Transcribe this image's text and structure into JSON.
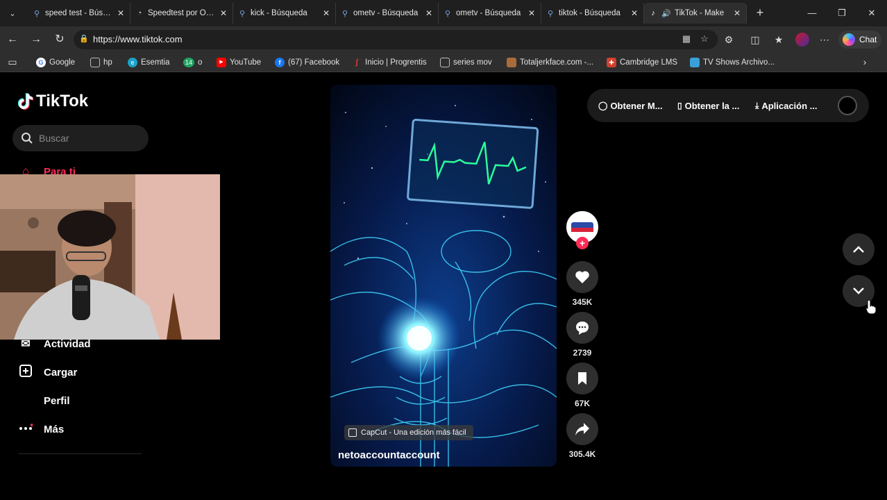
{
  "browser": {
    "tabs": [
      {
        "title": "speed test - Búsqueda",
        "icon": "search-icon"
      },
      {
        "title": "Speedtest por Ookla",
        "icon": "speedtest-icon"
      },
      {
        "title": "kick - Búsqueda",
        "icon": "search-icon"
      },
      {
        "title": "ometv - Búsqueda",
        "icon": "search-icon"
      },
      {
        "title": "ometv - Búsqueda",
        "icon": "search-icon"
      },
      {
        "title": "tiktok - Búsqueda",
        "icon": "search-icon"
      },
      {
        "title": "TikTok - Make",
        "icon": "tiktok-icon",
        "active": true,
        "audio": true
      }
    ],
    "url": "https://www.tiktok.com",
    "chat_label": "Chat",
    "bookmarks": [
      {
        "label": "Google",
        "icon": "google-icon",
        "color": "#4285f4"
      },
      {
        "label": "hp",
        "icon": "folder-icon",
        "color": "#888888"
      },
      {
        "label": "Esemtia",
        "icon": "esemtia-icon",
        "color": "#1aa3c9"
      },
      {
        "label": "o",
        "icon": "badge-14-icon",
        "color": "#1fa463",
        "badge": "14"
      },
      {
        "label": "YouTube",
        "icon": "youtube-icon",
        "color": "#ff0000"
      },
      {
        "label": "(67) Facebook",
        "icon": "facebook-icon",
        "color": "#1877f2"
      },
      {
        "label": "Inicio | Progrentis",
        "icon": "progrentis-icon",
        "color": "#e63b2e"
      },
      {
        "label": "series mov",
        "icon": "folder-icon",
        "color": "#888888"
      },
      {
        "label": "Totaljerkface.com -...",
        "icon": "site-icon",
        "color": "#aa6b3a"
      },
      {
        "label": "Cambridge LMS",
        "icon": "cambridge-icon",
        "color": "#d0402f"
      },
      {
        "label": "TV Shows Archivo...",
        "icon": "tv-icon",
        "color": "#3aa0d8"
      }
    ]
  },
  "tiktok": {
    "logo_text": "TikTok",
    "search_placeholder": "Buscar",
    "nav": [
      {
        "label": "Para ti",
        "icon": "home-icon",
        "active": true
      },
      {
        "label": "Actividad",
        "icon": "activity-icon"
      },
      {
        "label": "Cargar",
        "icon": "upload-icon"
      },
      {
        "label": "Perfil",
        "icon": "profile-icon"
      },
      {
        "label": "Más",
        "icon": "more-icon"
      }
    ],
    "top_pills": [
      {
        "label": "Obtener M...",
        "icon": "coin-icon"
      },
      {
        "label": "Obtener la ...",
        "icon": "phone-icon"
      },
      {
        "label": "Aplicación ...",
        "icon": "download-icon"
      }
    ],
    "video": {
      "author": "netoaccountaccount",
      "capcut_label": "CapCut - Una edición más fácil",
      "likes": "345K",
      "comments": "2739",
      "saves": "67K",
      "shares": "305.4K"
    }
  },
  "colors": {
    "accent": "#fe2c55",
    "ekg": "#2bff9a",
    "glow": "#3fd9ff"
  }
}
